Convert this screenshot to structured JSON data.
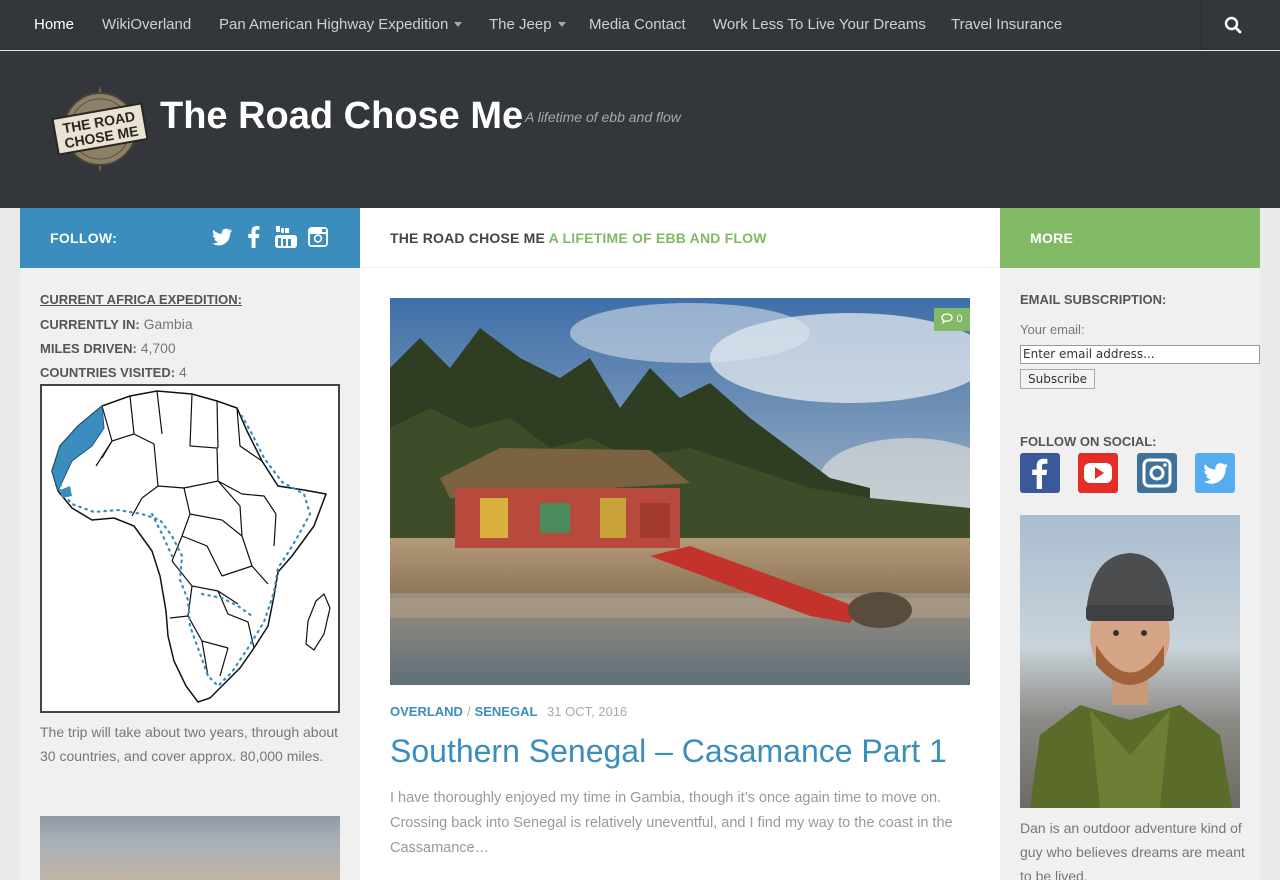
{
  "nav": {
    "items": [
      {
        "label": "Home"
      },
      {
        "label": "WikiOverland"
      },
      {
        "label": "Pan American Highway Expedition"
      },
      {
        "label": "The Jeep"
      },
      {
        "label": "Media Contact"
      },
      {
        "label": "Work Less To Live Your Dreams"
      },
      {
        "label": "Travel Insurance"
      }
    ],
    "search_icon": "search-icon"
  },
  "header": {
    "logo_text_line1": "THE ROAD",
    "logo_text_line2": "CHOSE ME",
    "site_title": "The Road Chose Me",
    "tagline": "A lifetime of ebb and flow"
  },
  "follow_bar": {
    "label": "FOLLOW:",
    "icons": [
      "twitter-icon",
      "facebook-icon",
      "youtube-icon",
      "instagram-icon"
    ]
  },
  "title_bar": {
    "site_name": "THE ROAD CHOSE ME",
    "tagline": "A LIFETIME OF EBB AND FLOW"
  },
  "more_bar": {
    "label": "MORE"
  },
  "left_sidebar": {
    "heading": "CURRENT AFRICA EXPEDITION:",
    "stats": [
      {
        "label": "CURRENTLY IN:",
        "value": "Gambia"
      },
      {
        "label": "MILES DRIVEN:",
        "value": "4,700"
      },
      {
        "label": "COUNTRIES VISITED:",
        "value": "4"
      }
    ],
    "trip_text": "The trip will take about two years, through about 30 countries, and cover approx. 80,000 miles."
  },
  "post": {
    "comment_count": "0",
    "categories": [
      "OVERLAND",
      "SENEGAL"
    ],
    "category_sep": "/",
    "date": "31 OCT, 2016",
    "title": "Southern Senegal – Casamance Part 1",
    "excerpt": "I have thoroughly enjoyed my time in Gambia, though it’s once again time to move on. Crossing back into Senegal is relatively uneventful, and I find my way to the coast in the Cassamance…"
  },
  "right_sidebar": {
    "email_title": "EMAIL SUBSCRIPTION:",
    "email_label": "Your email:",
    "email_value": "Enter email address...",
    "subscribe_label": "Subscribe",
    "social_title": "FOLLOW ON SOCIAL:",
    "bio": "Dan is an outdoor adventure kind of guy who believes dreams are meant to be lived."
  },
  "colors": {
    "nav_bg": "#33363b",
    "blue_accent": "#3b8dbd",
    "green_accent": "#82b965"
  }
}
